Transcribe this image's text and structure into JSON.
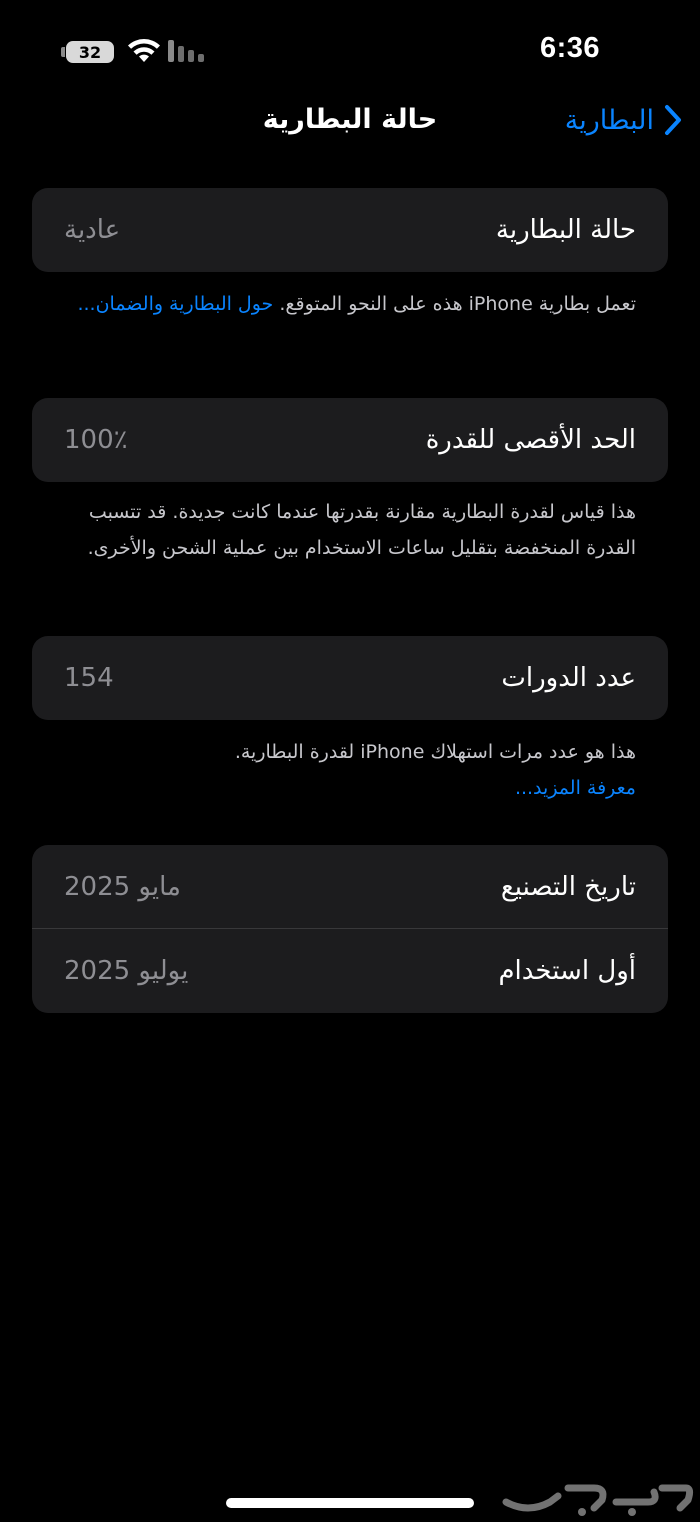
{
  "status": {
    "battery_level": "32",
    "time": "6:36"
  },
  "nav": {
    "back_label": "البطارية",
    "title": "حالة البطارية"
  },
  "health": {
    "label": "حالة البطارية",
    "value": "عادية",
    "footnote_text": "تعمل بطارية iPhone هذه على النحو المتوقع. ",
    "footnote_link": "حول البطارية والضمان..."
  },
  "capacity": {
    "label": "الحد الأقصى للقدرة",
    "value": "100٪",
    "footnote_text": "هذا قياس لقدرة البطارية مقارنة بقدرتها عندما كانت جديدة. قد تتسبب القدرة المنخفضة بتقليل ساعات الاستخدام بين عملية الشحن والأخرى."
  },
  "cycles": {
    "label": "عدد الدورات",
    "value": "154",
    "footnote_text": "هذا هو عدد مرات استهلاك iPhone لقدرة البطارية.",
    "footnote_link": "معرفة المزيد..."
  },
  "dates": {
    "manufacture_label": "تاريخ التصنيع",
    "manufacture_value": "مايو 2025",
    "first_use_label": "أول استخدام",
    "first_use_value": "يوليو 2025"
  },
  "icons": {
    "wifi": "wifi-icon",
    "signal": "cellular-signal-icon",
    "back": "chevron-right-icon",
    "watermark": "haraj-watermark-logo"
  },
  "colors": {
    "accent": "#0a84ff",
    "card": "#1c1c1e",
    "secondary_text": "#8e8e93"
  }
}
